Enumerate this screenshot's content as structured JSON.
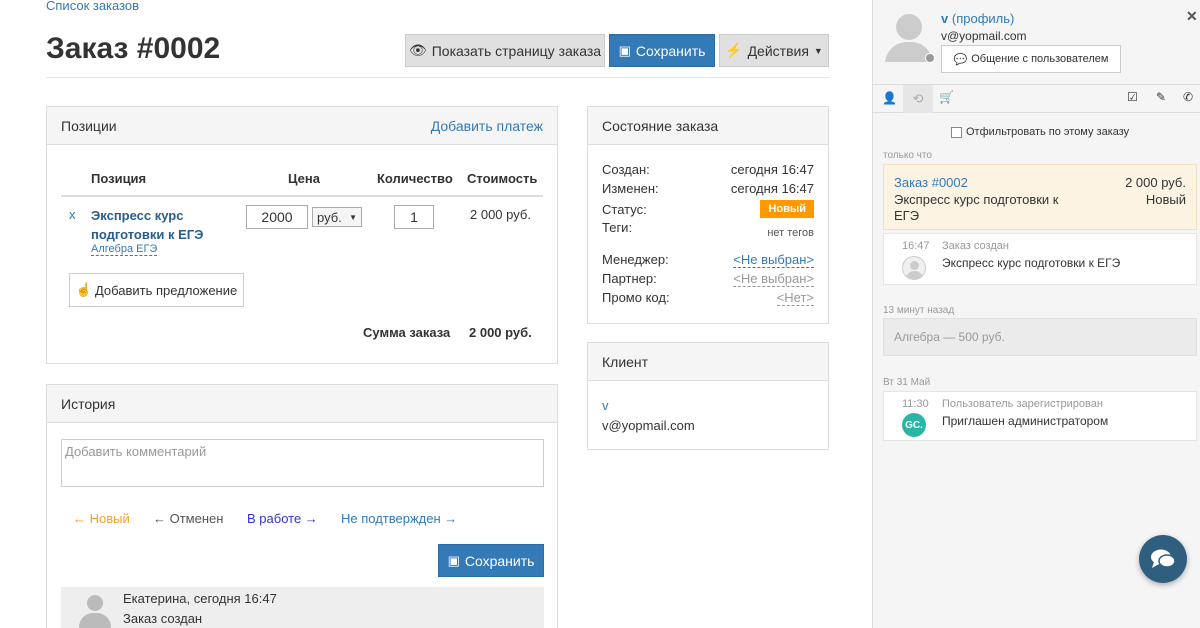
{
  "breadcrumb": "Список заказов",
  "title": "Заказ #0002",
  "toolbar": {
    "show_page": "Показать страницу заказа",
    "save": "Сохранить",
    "actions": "Действия"
  },
  "positions": {
    "heading": "Позиции",
    "add_payment": "Добавить платеж",
    "columns": [
      "Позиция",
      "Цена",
      "Количество",
      "Стоимость"
    ],
    "item": {
      "remove": "x",
      "name_line1": "Экспресс курс",
      "name_line2": "подготовки к ЕГЭ",
      "subtitle": "Алгебра ЕГЭ",
      "price": "2000",
      "currency": "руб.",
      "quantity": "1",
      "cost": "2 000 руб."
    },
    "add_offer": "Добавить предложение",
    "total_label": "Сумма заказа",
    "total_value": "2 000 руб."
  },
  "history": {
    "heading": "История",
    "comment_placeholder": "Добавить комментарий",
    "statuses": [
      {
        "label": "← Новый",
        "color": "#f0a030"
      },
      {
        "label": "← Отменен",
        "color": "#555555"
      },
      {
        "label": "В работе →",
        "color": "#3333cc"
      },
      {
        "label": "Не подтвержден →",
        "color": "#337ab7"
      }
    ],
    "save": "Сохранить",
    "entry_author": "Екатерина, сегодня 16:47",
    "entry_text": "Заказ создан"
  },
  "order_state": {
    "heading": "Состояние заказа",
    "created_label": "Создан:",
    "created_value": "сегодня 16:47",
    "changed_label": "Изменен:",
    "changed_value": "сегодня 16:47",
    "status_label": "Статус:",
    "status_value": "Новый",
    "tags_label": "Теги:",
    "tags_value": "нет тегов",
    "manager_label": "Менеджер:",
    "manager_value": "<Не выбран>",
    "partner_label": "Партнер:",
    "partner_value": "<Не выбран>",
    "promo_label": "Промо код:",
    "promo_value": "<Нет>"
  },
  "client": {
    "heading": "Клиент",
    "name": "v",
    "email": "v@yopmail.com"
  },
  "sidebar": {
    "user_name": "v",
    "profile_link": "(профиль)",
    "user_email": "v@yopmail.com",
    "chat_button": "Общение с пользователем",
    "filter_label": "Отфильтровать по этому заказу",
    "group1": "только что",
    "order_link": "Заказ #0002",
    "order_amount": "2 000 руб.",
    "order_course_line1": "Экспресс курс подготовки к",
    "order_course_line2": "ЕГЭ",
    "order_status": "Новый",
    "event_time": "16:47",
    "event_title": "Заказ создан",
    "event_text": "Экспресс курс подготовки к ЕГЭ",
    "group2": "13 минут назад",
    "note": "Алгебра — 500 руб.",
    "group3": "Вт 31 Май",
    "reg_time": "11:30",
    "reg_title": "Пользователь зарегистрирован",
    "reg_text": "Приглашен администратором",
    "reg_avatar": "GC."
  },
  "colors": {
    "accent": "#337ab7",
    "badge": "#ff9900",
    "chat_fab": "#2f5f7f"
  }
}
